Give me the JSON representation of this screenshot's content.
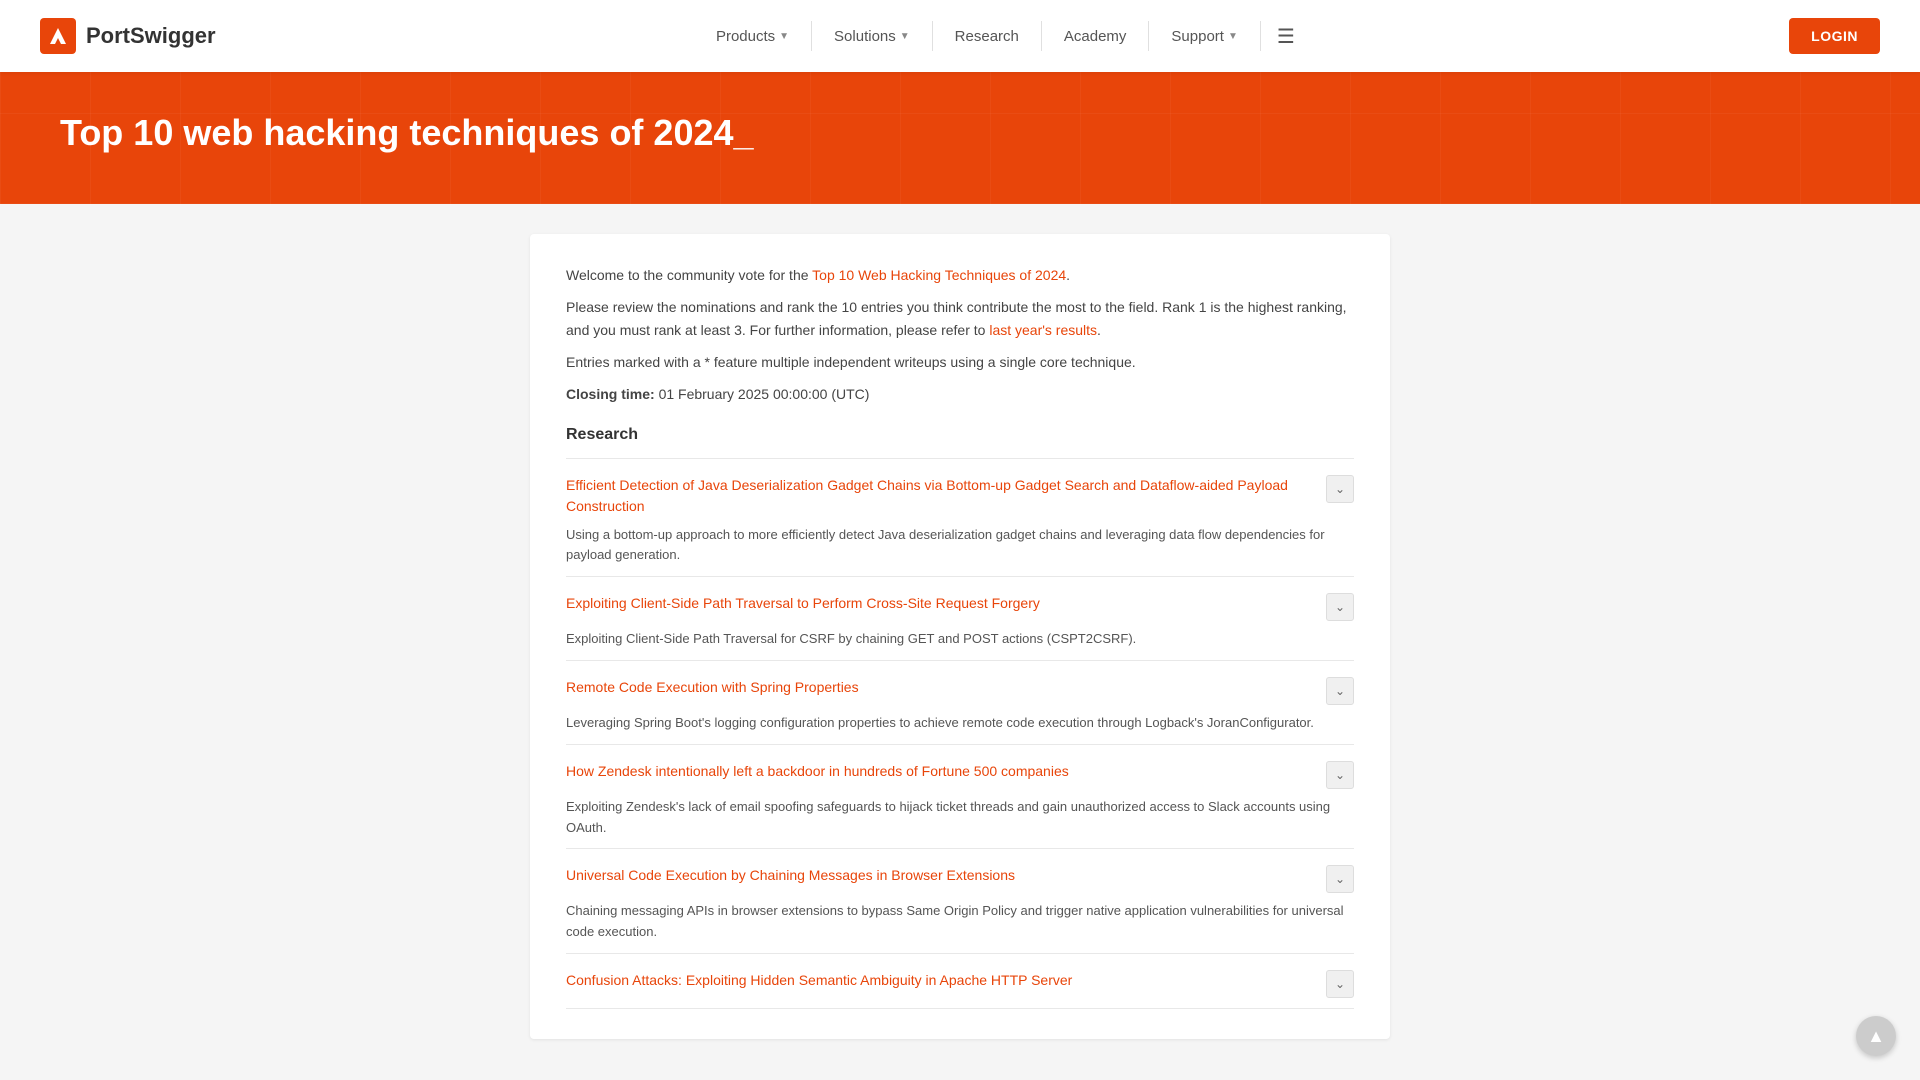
{
  "header": {
    "logo_text": "PortSwigger",
    "login_label": "LOGIN",
    "nav": [
      {
        "label": "Products",
        "has_dropdown": true
      },
      {
        "label": "Solutions",
        "has_dropdown": true
      },
      {
        "label": "Research",
        "has_dropdown": false
      },
      {
        "label": "Academy",
        "has_dropdown": false
      },
      {
        "label": "Support",
        "has_dropdown": true
      }
    ]
  },
  "hero": {
    "title": "Top 10 web hacking techniques of 2024"
  },
  "content": {
    "intro_paragraph1": "Welcome to the community vote for the ",
    "intro_link1_text": "Top 10 Web Hacking Techniques of 2024",
    "intro_paragraph1_end": ".",
    "intro_paragraph2": "Please review the nominations and rank the 10 entries you think contribute the most to the field. Rank 1 is the highest ranking, and you must rank at least 3. For further information, please refer to ",
    "intro_link2_text": "last year's results",
    "intro_paragraph2_end": ".",
    "entries_note": "Entries marked with a * feature multiple independent writeups using a single core technique.",
    "closing_label": "Closing time:",
    "closing_value": "01 February 2025 00:00:00 (UTC)",
    "section_heading": "Research",
    "entries": [
      {
        "title": "Efficient Detection of Java Deserialization Gadget Chains via Bottom-up Gadget Search and Dataflow-aided Payload Construction",
        "desc": "Using a bottom-up approach to more efficiently detect Java deserialization gadget chains and leveraging data flow dependencies for payload generation."
      },
      {
        "title": "Exploiting Client-Side Path Traversal to Perform Cross-Site Request Forgery",
        "desc": "Exploiting Client-Side Path Traversal for CSRF by chaining GET and POST actions (CSPT2CSRF)."
      },
      {
        "title": "Remote Code Execution with Spring Properties",
        "desc": "Leveraging Spring Boot's logging configuration properties to achieve remote code execution through Logback's JoranConfigurator."
      },
      {
        "title": "How Zendesk intentionally left a backdoor in hundreds of Fortune 500 companies",
        "desc": "Exploiting Zendesk's lack of email spoofing safeguards to hijack ticket threads and gain unauthorized access to Slack accounts using OAuth."
      },
      {
        "title": "Universal Code Execution by Chaining Messages in Browser Extensions",
        "desc": "Chaining messaging APIs in browser extensions to bypass Same Origin Policy and trigger native application vulnerabilities for universal code execution."
      },
      {
        "title": "Confusion Attacks: Exploiting Hidden Semantic Ambiguity in Apache HTTP Server",
        "desc": ""
      }
    ]
  }
}
